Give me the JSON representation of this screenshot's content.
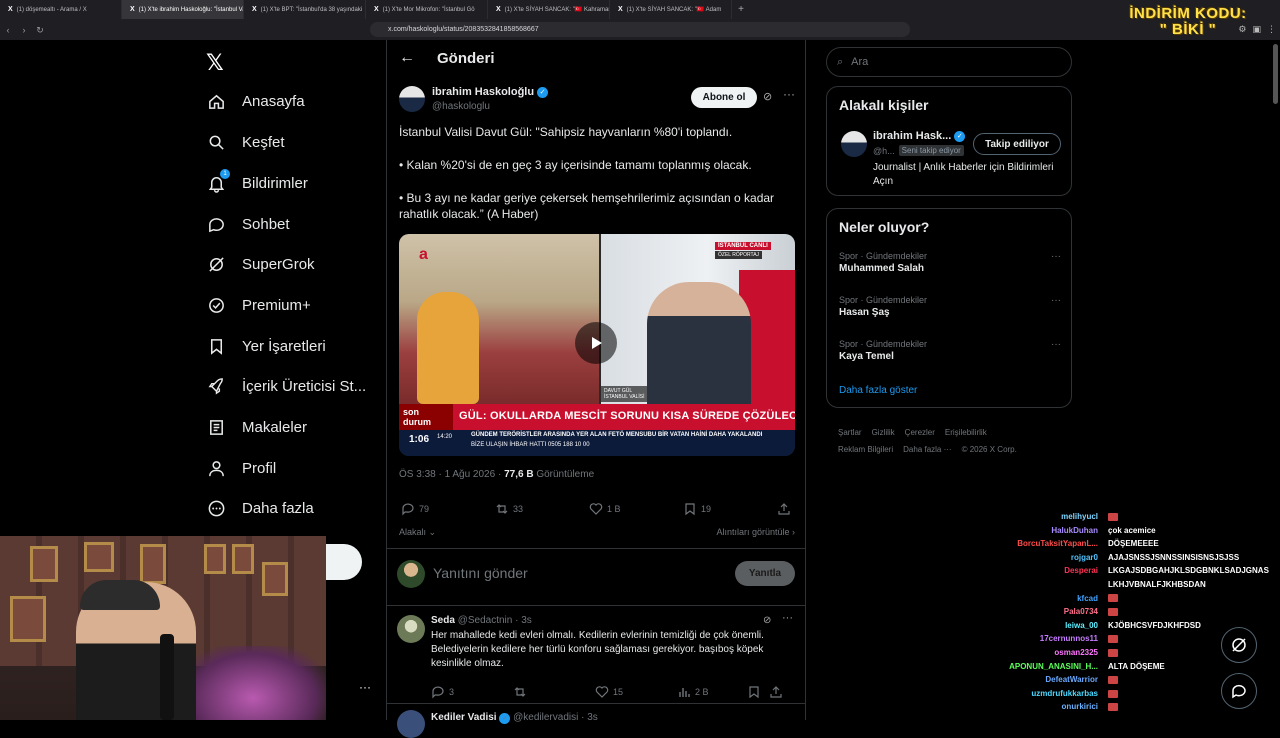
{
  "browser": {
    "tabs": [
      {
        "label": "(1) döşemealtı - Arama / X",
        "active": false
      },
      {
        "label": "(1) X'te ibrahim Haskoloğlu: \"İstanbul Valisi",
        "active": true
      },
      {
        "label": "(1) X'te BPT: \"İstanbul'da 38 yaşındaki",
        "active": false
      },
      {
        "label": "(1) X'te Mor Mikrofon: \"İstanbul Gö",
        "active": false
      },
      {
        "label": "(1) X'te SİYAH SANCAK: \"🇹🇷 Kahraman",
        "active": false
      },
      {
        "label": "(1) X'te SİYAH SANCAK: \"🇹🇷 Adam",
        "active": false
      }
    ],
    "url": "x.com/haskologlu/status/2083532841858568667",
    "promo_line1": "İNDİRİM KODU:",
    "promo_line2": "\" BİKİ \""
  },
  "sidebar": {
    "items": [
      {
        "label": "Anasayfa",
        "icon": "home-icon"
      },
      {
        "label": "Keşfet",
        "icon": "search-icon"
      },
      {
        "label": "Bildirimler",
        "icon": "bell-icon",
        "badge": "1"
      },
      {
        "label": "Sohbet",
        "icon": "chat-icon"
      },
      {
        "label": "SuperGrok",
        "icon": "grok-icon"
      },
      {
        "label": "Premium+",
        "icon": "premium-icon"
      },
      {
        "label": "Yer İşaretleri",
        "icon": "bookmark-icon"
      },
      {
        "label": "İçerik Üreticisi St...",
        "icon": "rocket-icon"
      },
      {
        "label": "Makaleler",
        "icon": "article-icon"
      },
      {
        "label": "Profil",
        "icon": "profile-icon"
      },
      {
        "label": "Daha fazla",
        "icon": "more-circle-icon"
      }
    ]
  },
  "main": {
    "title": "Gönderi",
    "post": {
      "author": "ibrahim Haskoloğlu",
      "handle": "@haskologlu",
      "follow_label": "Abone ol",
      "text": [
        "İstanbul Valisi Davut Gül: \"Sahipsiz hayvanların %80'i toplandı.",
        "• Kalan %20'si de en geç 3 ay içerisinde tamamı toplanmış olacak.",
        "• Bu 3 ayı ne kadar geriye çekersek hemşehrilerimiz açısından o kadar rahatlık olacak.” (A Haber)"
      ],
      "video": {
        "duration": "1:06",
        "live_tag": "İSTANBUL  CANLI",
        "live_sub": "ÖZEL RÖPORTAJ",
        "name_box_1": "DAVUT GÜL",
        "name_box_2": "İSTANBUL VALİSİ",
        "son_durum": "son durum",
        "headline": "GÜL: OKULLARDA MESCİT SORUNU KISA SÜREDE ÇÖZÜLECEK",
        "ticker_time": "14:20",
        "ticker_gundem": "GÜNDEM   TERÖRİSTLER ARASINDA YER ALAN FETÖ MENSUBU BİR VATAN HAİNİ DAHA YAKALANDI",
        "ticker_bize": "BİZE ULAŞIN   İHBAR HATTI   0505 188 10 00"
      },
      "time": "ÖS 3:38 · 1 Ağu 2026 · ",
      "views_count": "77,6 B",
      "views_label": " Görüntüleme",
      "stats": {
        "replies": "79",
        "reposts": "33",
        "likes": "1 B",
        "bookmarks": "19"
      },
      "related_label": "Alakalı",
      "quotes_label": "Alıntıları görüntüle"
    },
    "compose": {
      "placeholder": "Yanıtını gönder",
      "button": "Yanıtla"
    },
    "reply": {
      "name": "Seda",
      "handle": "@Sedactnin",
      "time": "3s",
      "text": "Her mahallede kedi evleri olmalı. Kedilerin evlerinin temizliği de çok önemli. Belediyelerin kedilere her türlü konforu sağlaması gerekiyor. başıboş köpek kesinlikle olmaz.",
      "stats": {
        "replies": "3",
        "likes": "15",
        "views": "2 B"
      }
    },
    "next_reply": {
      "name": "Kediler Vadisi",
      "handle": "@kedilervadisi",
      "time": "3s"
    }
  },
  "right": {
    "search_placeholder": "Ara",
    "related": {
      "title": "Alakalı kişiler",
      "name": "ibrahim Hask...",
      "handle": "@h...",
      "follows_you": "Seni takip ediyor",
      "button": "Takip ediliyor",
      "bio": "Journalist | Anlık Haberler için Bildirimleri Açın"
    },
    "trends": {
      "title": "Neler oluyor?",
      "items": [
        {
          "category": "Spor · Gündemdekiler",
          "name": "Muhammed Salah"
        },
        {
          "category": "Spor · Gündemdekiler",
          "name": "Hasan Şaş"
        },
        {
          "category": "Spor · Gündemdekiler",
          "name": "Kaya Temel"
        }
      ],
      "show_more": "Daha fazla göster"
    },
    "footer": [
      "Şartlar",
      "Gizlilik",
      "Çerezler",
      "Erişilebilirlik",
      "Reklam Bilgileri",
      "Daha fazla ···",
      "© 2026 X Corp."
    ]
  },
  "stream_chat": [
    {
      "user": "melihyucl",
      "color": "#7fd4ff",
      "msg": ""
    },
    {
      "user": "HalukDuhan",
      "color": "#a98bff",
      "msg": "çok acemice"
    },
    {
      "user": "BorcuTaksitYapanL...",
      "color": "#ff4b4b",
      "msg": "DÖŞEMEEEE"
    },
    {
      "user": "rojgar0",
      "color": "#4fc3ff",
      "msg": "AJAJSNSSJSNNSSINSISNSJSJSS"
    },
    {
      "user": "Desperai",
      "color": "#ff3355",
      "msg": "LKGAJSDBGAHJKLSDGBNKLSADJGNAS"
    },
    {
      "user": "",
      "color": "#fff",
      "msg": "LKHJVBNALFJKHBSDAN"
    },
    {
      "user": "kfcad",
      "color": "#3fa3ff",
      "msg": ""
    },
    {
      "user": "Pala0734",
      "color": "#ff6f8b",
      "msg": ""
    },
    {
      "user": "leiwa_00",
      "color": "#5ff0ff",
      "msg": "KJÖBHCSVFDJKHFDSD"
    },
    {
      "user": "17cernunnos11",
      "color": "#c77dff",
      "msg": ""
    },
    {
      "user": "osman2325",
      "color": "#ff77ff",
      "msg": ""
    },
    {
      "user": "APONUN_ANASINI_H...",
      "color": "#5cff5c",
      "msg": "ALTA DÖŞEME"
    },
    {
      "user": "DefeatWarrior",
      "color": "#6aa8ff",
      "msg": ""
    },
    {
      "user": "uzmdrufukkarbas",
      "color": "#4ad9ff",
      "msg": ""
    },
    {
      "user": "onurkirici",
      "color": "#6ab0ff",
      "msg": ""
    }
  ]
}
